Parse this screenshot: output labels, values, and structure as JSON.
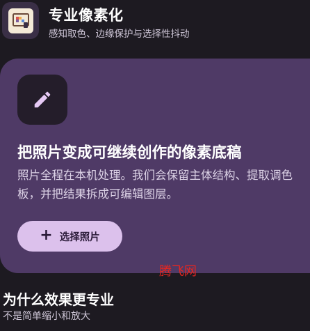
{
  "header": {
    "icon": "pixel-frame-icon",
    "title": "专业像素化",
    "subtitle": "感知取色、边缘保护与选择性抖动"
  },
  "hero": {
    "icon": "pencil-icon",
    "title": "把照片变成可继续创作的像素底稿",
    "description": "照片全程在本机处理。我们会保留主体结构、提取调色板，并把结果拆成可编辑图层。",
    "button_label": "选择照片",
    "button_icon": "plus-icon"
  },
  "watermark": "腾飞网",
  "section": {
    "title": "为什么效果更专业",
    "subtitle": "不是简单缩小和放大"
  },
  "colors": {
    "background": "#1d1a21",
    "card": "#4f3a66",
    "button": "#dcc1ec",
    "watermark": "#e8261f"
  }
}
